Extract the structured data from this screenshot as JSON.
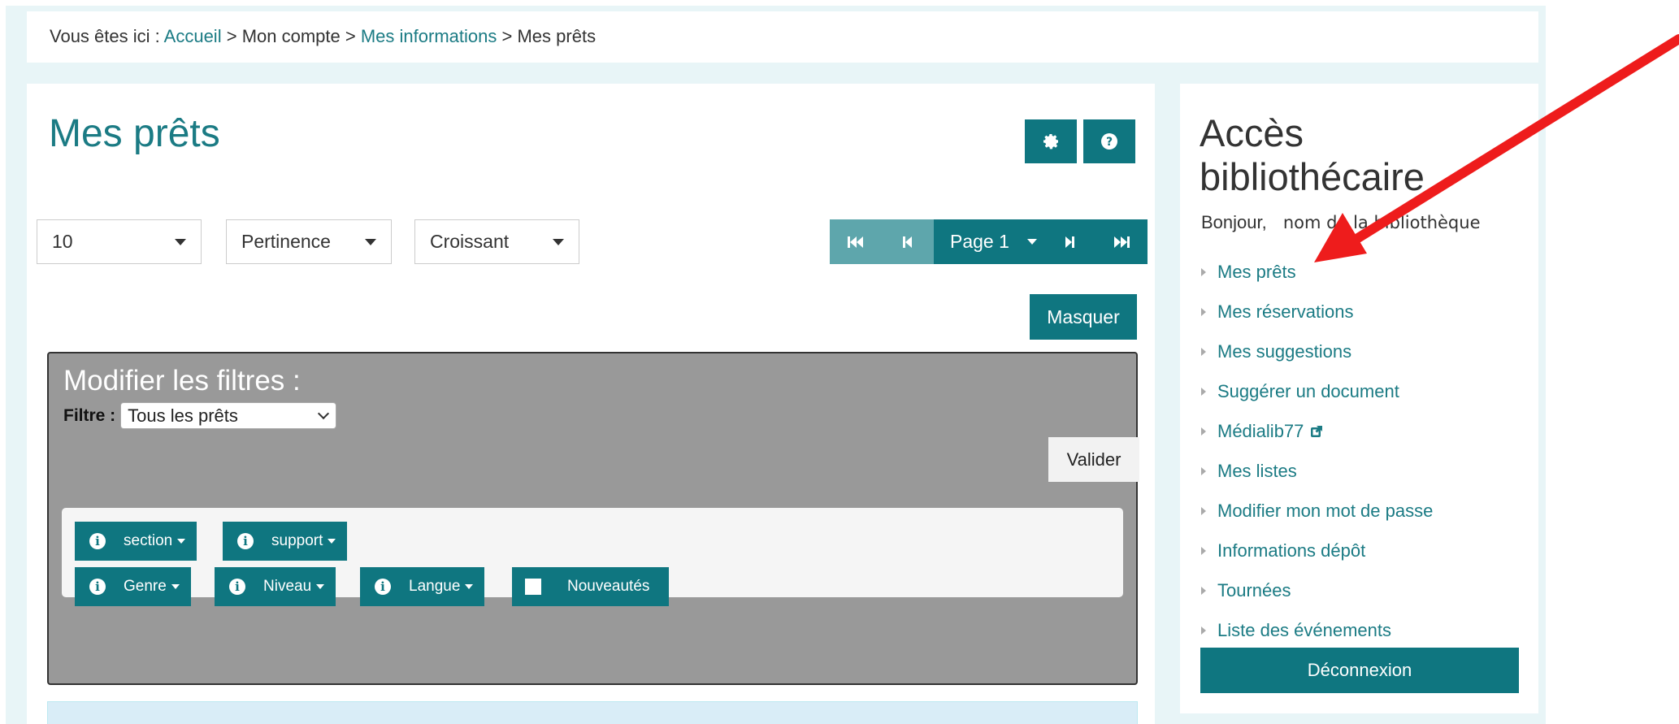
{
  "breadcrumb": {
    "prefix": "Vous êtes ici :",
    "home": "Accueil",
    "sep1": ">",
    "account": "Mon compte",
    "sep2": ">",
    "info": "Mes informations",
    "sep3": ">",
    "current": "Mes prêts"
  },
  "main": {
    "title": "Mes prêts",
    "settings_icon": "gear-icon",
    "help_icon": "question-icon",
    "per_page": "10",
    "sort_by": "Pertinence",
    "order": "Croissant",
    "pagination": {
      "page_label": "Page 1"
    },
    "hide_button": "Masquer",
    "filters": {
      "title": "Modifier les filtres :",
      "filter_label": "Filtre :",
      "filter_value": "Tous les prêts",
      "submit": "Valider",
      "facets": [
        "section",
        "support",
        "Genre",
        "Niveau",
        "Langue"
      ],
      "new_items": "Nouveautés"
    }
  },
  "sidebar": {
    "title": "Accès bibliothécaire",
    "greeting": "Bonjour,",
    "library_name": "nom de la bibliothèque",
    "items": [
      "Mes prêts",
      "Mes réservations",
      "Mes suggestions",
      "Suggérer un document",
      "Médialib77",
      "Mes listes",
      "Modifier mon mot de passe",
      "Informations dépôt",
      "Tournées",
      "Liste des événements"
    ],
    "logout": "Déconnexion"
  },
  "colors": {
    "accent": "#0f7680",
    "link": "#1b7b84",
    "annotation_arrow": "#ee1c1c"
  }
}
